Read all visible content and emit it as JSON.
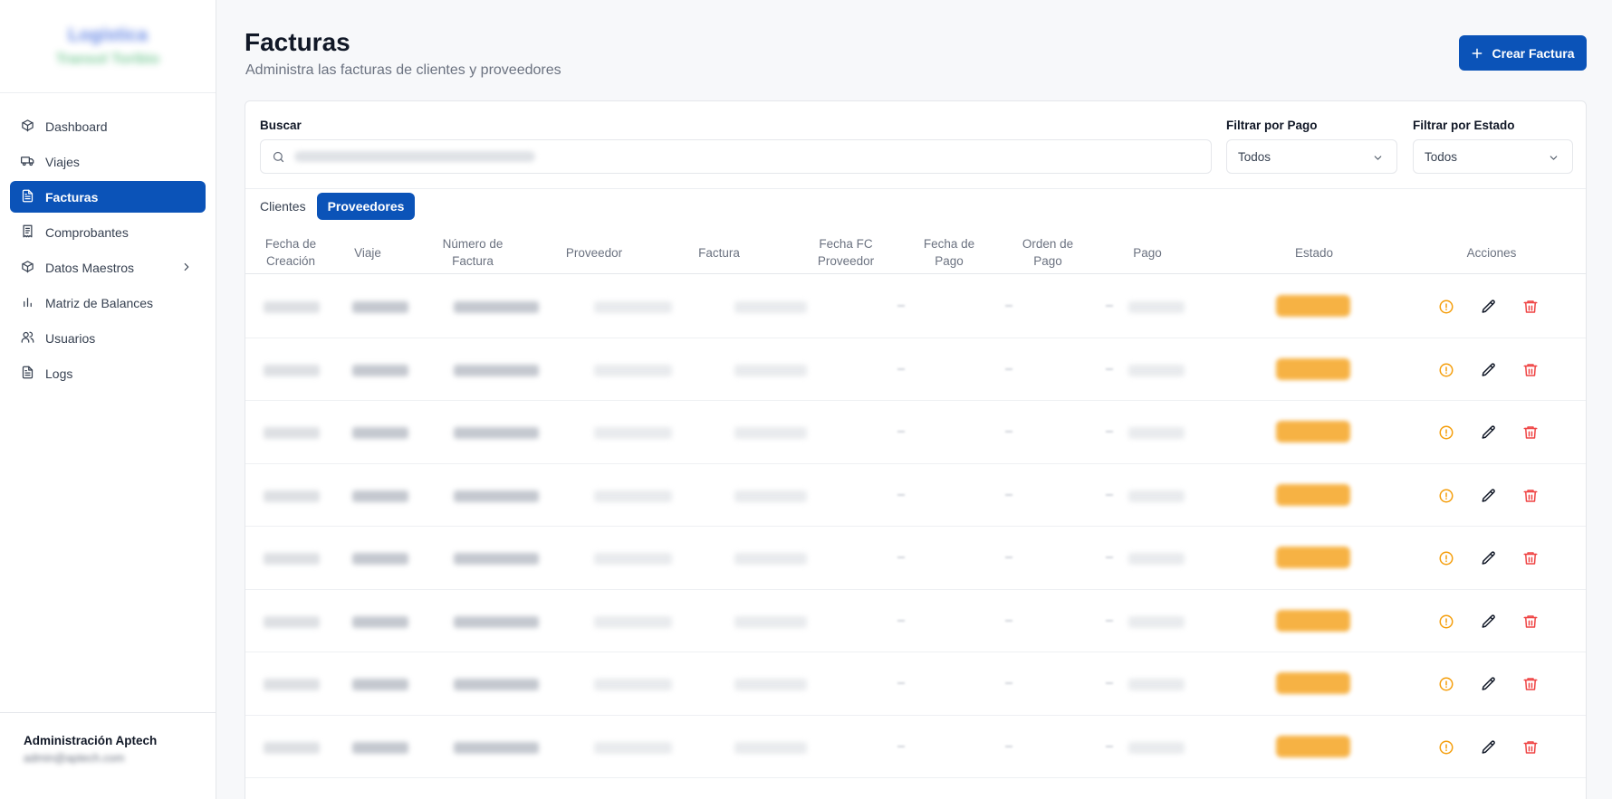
{
  "sidebar": {
    "logo": {
      "line1": "Logística",
      "line2": "Transol Toribio"
    },
    "items": [
      {
        "label": "Dashboard",
        "icon": "cube-icon",
        "active": false
      },
      {
        "label": "Viajes",
        "icon": "truck-icon",
        "active": false
      },
      {
        "label": "Facturas",
        "icon": "file-text-icon",
        "active": true
      },
      {
        "label": "Comprobantes",
        "icon": "receipt-icon",
        "active": false
      },
      {
        "label": "Datos Maestros",
        "icon": "cube-icon",
        "active": false
      },
      {
        "label": "Matriz de Balances",
        "icon": "bar-chart-icon",
        "active": false
      },
      {
        "label": "Usuarios",
        "icon": "users-icon",
        "active": false
      },
      {
        "label": "Logs",
        "icon": "file-text-icon",
        "active": false
      }
    ],
    "footer": {
      "name": "Administración Aptech",
      "email": "admin@aptech.com"
    }
  },
  "header": {
    "title": "Facturas",
    "subtitle": "Administra las facturas de clientes y proveedores",
    "create_label": "Crear Factura"
  },
  "filters": {
    "search_label": "Buscar",
    "pago_label": "Filtrar por Pago",
    "pago_value": "Todos",
    "estado_label": "Filtrar por Estado",
    "estado_value": "Todos"
  },
  "tabs": [
    {
      "label": "Clientes",
      "active": false
    },
    {
      "label": "Proveedores",
      "active": true
    }
  ],
  "table": {
    "columns": [
      "Fecha de\nCreación",
      "Viaje",
      "Número de\nFactura",
      "Proveedor",
      "Factura",
      "Fecha FC\nProveedor",
      "Fecha de\nPago",
      "Orden de\nPago",
      "Pago",
      "Estado",
      "Acciones"
    ],
    "row_actions": [
      "info-icon",
      "pencil-icon",
      "trash-icon"
    ]
  },
  "colors": {
    "primary": "#0b53b8",
    "status_badge": "#f5a524",
    "info_icon": "#f59e0b",
    "delete_icon": "#ef4444"
  }
}
